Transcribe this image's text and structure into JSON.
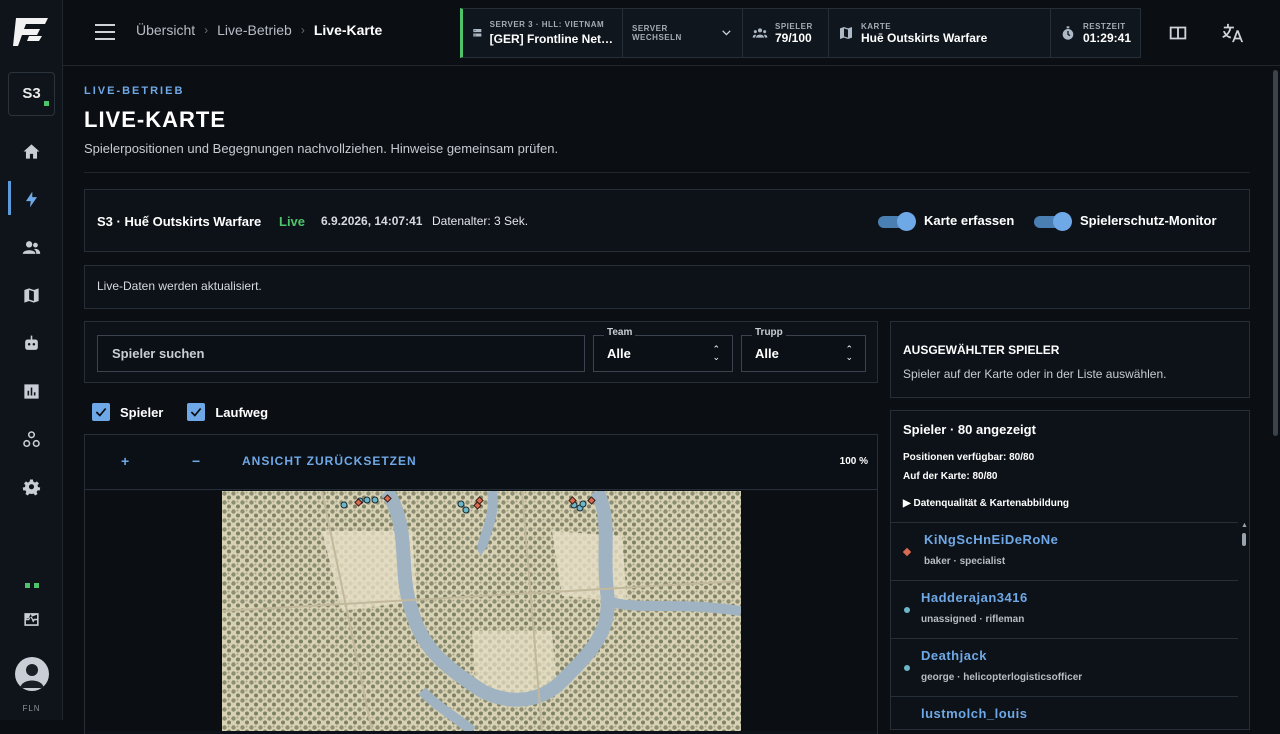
{
  "sidebar": {
    "server_badge": "S3",
    "footer_label": "FLN"
  },
  "header": {
    "breadcrumbs": [
      "Übersicht",
      "Live-Betrieb",
      "Live-Karte"
    ],
    "server_label": "SERVER 3 · HLL: VIETNAM",
    "server_name": "[GER] Frontline Net…",
    "switch_label": "SERVER WECHSELN",
    "players_label": "SPIELER",
    "players_value": "79/100",
    "map_label": "KARTE",
    "map_value": "Huē Outskirts Warfare",
    "time_label": "RESTZEIT",
    "time_value": "01:29:41"
  },
  "page": {
    "eyebrow": "LIVE-BETRIEB",
    "title": "LIVE-KARTE",
    "subtitle": "Spielerpositionen und Begegnungen nachvollziehen. Hinweise gemeinsam prüfen."
  },
  "infobar": {
    "map": "S3 · Huế Outskirts Warfare",
    "live": "Live",
    "timestamp": "6.9.2026, 14:07:41",
    "age": "Datenalter: 3 Sek.",
    "toggle1": "Karte erfassen",
    "toggle2": "Spielerschutz-Monitor"
  },
  "notice": "Live-Daten werden aktualisiert.",
  "filters": {
    "search_placeholder": "Spieler suchen",
    "team_label": "Team",
    "team_value": "Alle",
    "squad_label": "Trupp",
    "squad_value": "Alle"
  },
  "checkboxes": {
    "players": "Spieler",
    "path": "Laufweg"
  },
  "mapcontrols": {
    "zoom_in": "+",
    "zoom_out": "−",
    "reset": "ANSICHT ZURÜCKSETZEN",
    "zoom": "100 %"
  },
  "selected": {
    "heading": "AUSGEWÄHLTER SPIELER",
    "hint": "Spieler auf der Karte oder in der Liste auswählen."
  },
  "playerlist": {
    "heading": "Spieler · 80 angezeigt",
    "positions": "Positionen verfügbar: 80/80",
    "on_map": "Auf der Karte: 80/80",
    "data_quality": "▶ Datenqualität & Kartenabbildung",
    "players": [
      {
        "name": "KiNgScHnEiDeRoNe",
        "detail": "baker · specialist",
        "marker": "diamond"
      },
      {
        "name": "Hadderajan3416",
        "detail": "unassigned · rifleman",
        "marker": "dot"
      },
      {
        "name": "Deathjack",
        "detail": "george · helicopterlogisticsofficer",
        "marker": "dot"
      },
      {
        "name": "lustmolch_louis",
        "detail": "",
        "marker": "dot"
      }
    ]
  },
  "colors": {
    "accent": "#6fa8e6",
    "live_green": "#4ec36a",
    "axis_red": "#d86a52",
    "allies_teal": "#6cb6c7"
  }
}
